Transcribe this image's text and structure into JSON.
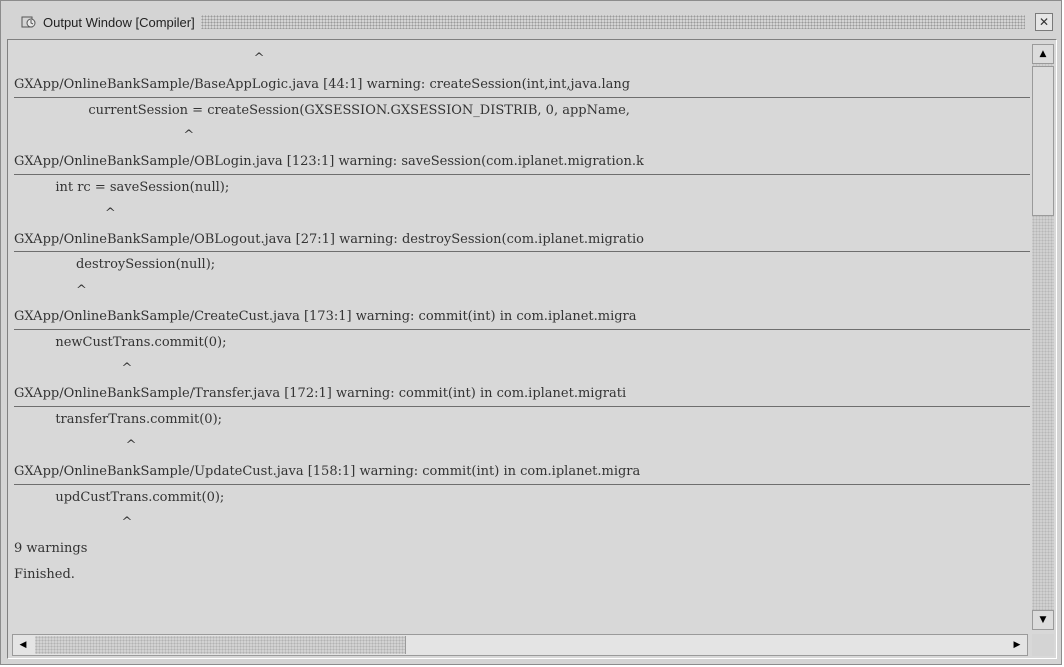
{
  "window": {
    "title": "Output Window [Compiler]",
    "close_glyph": "✕"
  },
  "output": {
    "lines": [
      {
        "kind": "caret",
        "text": "                                                          ^"
      },
      {
        "kind": "file",
        "text": "GXApp/OnlineBankSample/BaseAppLogic.java [44:1] warning: createSession(int,int,java.lang"
      },
      {
        "kind": "code",
        "text": "                  currentSession = createSession(GXSESSION.GXSESSION_DISTRIB, 0, appName,"
      },
      {
        "kind": "caret",
        "text": "                                         ^"
      },
      {
        "kind": "file",
        "text": "GXApp/OnlineBankSample/OBLogin.java [123:1] warning: saveSession(com.iplanet.migration.k"
      },
      {
        "kind": "code",
        "text": "          int rc = saveSession(null);"
      },
      {
        "kind": "caret",
        "text": "                      ^"
      },
      {
        "kind": "file",
        "text": "GXApp/OnlineBankSample/OBLogout.java [27:1] warning: destroySession(com.iplanet.migratio"
      },
      {
        "kind": "code",
        "text": "               destroySession(null);"
      },
      {
        "kind": "caret",
        "text": "               ^"
      },
      {
        "kind": "file",
        "text": "GXApp/OnlineBankSample/CreateCust.java [173:1] warning: commit(int) in com.iplanet.migra"
      },
      {
        "kind": "code",
        "text": "          newCustTrans.commit(0);"
      },
      {
        "kind": "caret",
        "text": "                          ^"
      },
      {
        "kind": "file",
        "text": "GXApp/OnlineBankSample/Transfer.java [172:1] warning: commit(int) in com.iplanet.migrati"
      },
      {
        "kind": "code",
        "text": "          transferTrans.commit(0);"
      },
      {
        "kind": "caret",
        "text": "                           ^"
      },
      {
        "kind": "file",
        "text": "GXApp/OnlineBankSample/UpdateCust.java [158:1] warning: commit(int) in com.iplanet.migra"
      },
      {
        "kind": "code",
        "text": "          updCustTrans.commit(0);"
      },
      {
        "kind": "caret",
        "text": "                          ^"
      },
      {
        "kind": "summary",
        "text": "9 warnings"
      },
      {
        "kind": "summary",
        "text": "Finished."
      }
    ]
  },
  "scrollbars": {
    "up_arrow": "▲",
    "down_arrow": "▼",
    "left_arrow": "◀",
    "right_arrow": "▶"
  }
}
